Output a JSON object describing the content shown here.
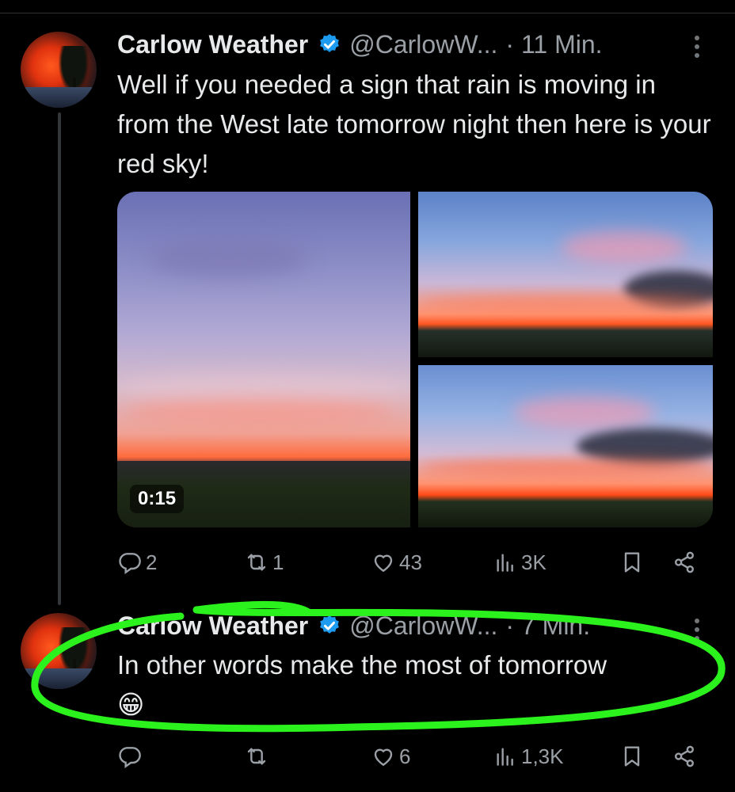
{
  "colors": {
    "background": "#000000",
    "text": "#e7e9ea",
    "muted": "#9aa0a6",
    "verified": "#1d9bf0",
    "highlight": "#2bf21c"
  },
  "tweets": [
    {
      "name": "Carlow Weather",
      "handle": "@CarlowW...",
      "time": "· 11 Min.",
      "text": "Well if you needed a sign that rain is moving in from the West late tomorrow night then here is your red sky!",
      "media": {
        "video_duration": "0:15",
        "photo_count": 3
      },
      "actions": {
        "replies": "2",
        "reposts": "1",
        "likes": "43",
        "views": "3K"
      }
    },
    {
      "name": "Carlow Weather",
      "handle": "@CarlowW...",
      "time": "· 7 Min.",
      "text": "In other words make the most of tomorrow",
      "emoji": "😁",
      "actions": {
        "replies": "",
        "reposts": "",
        "likes": "6",
        "views": "1,3K"
      }
    }
  ]
}
